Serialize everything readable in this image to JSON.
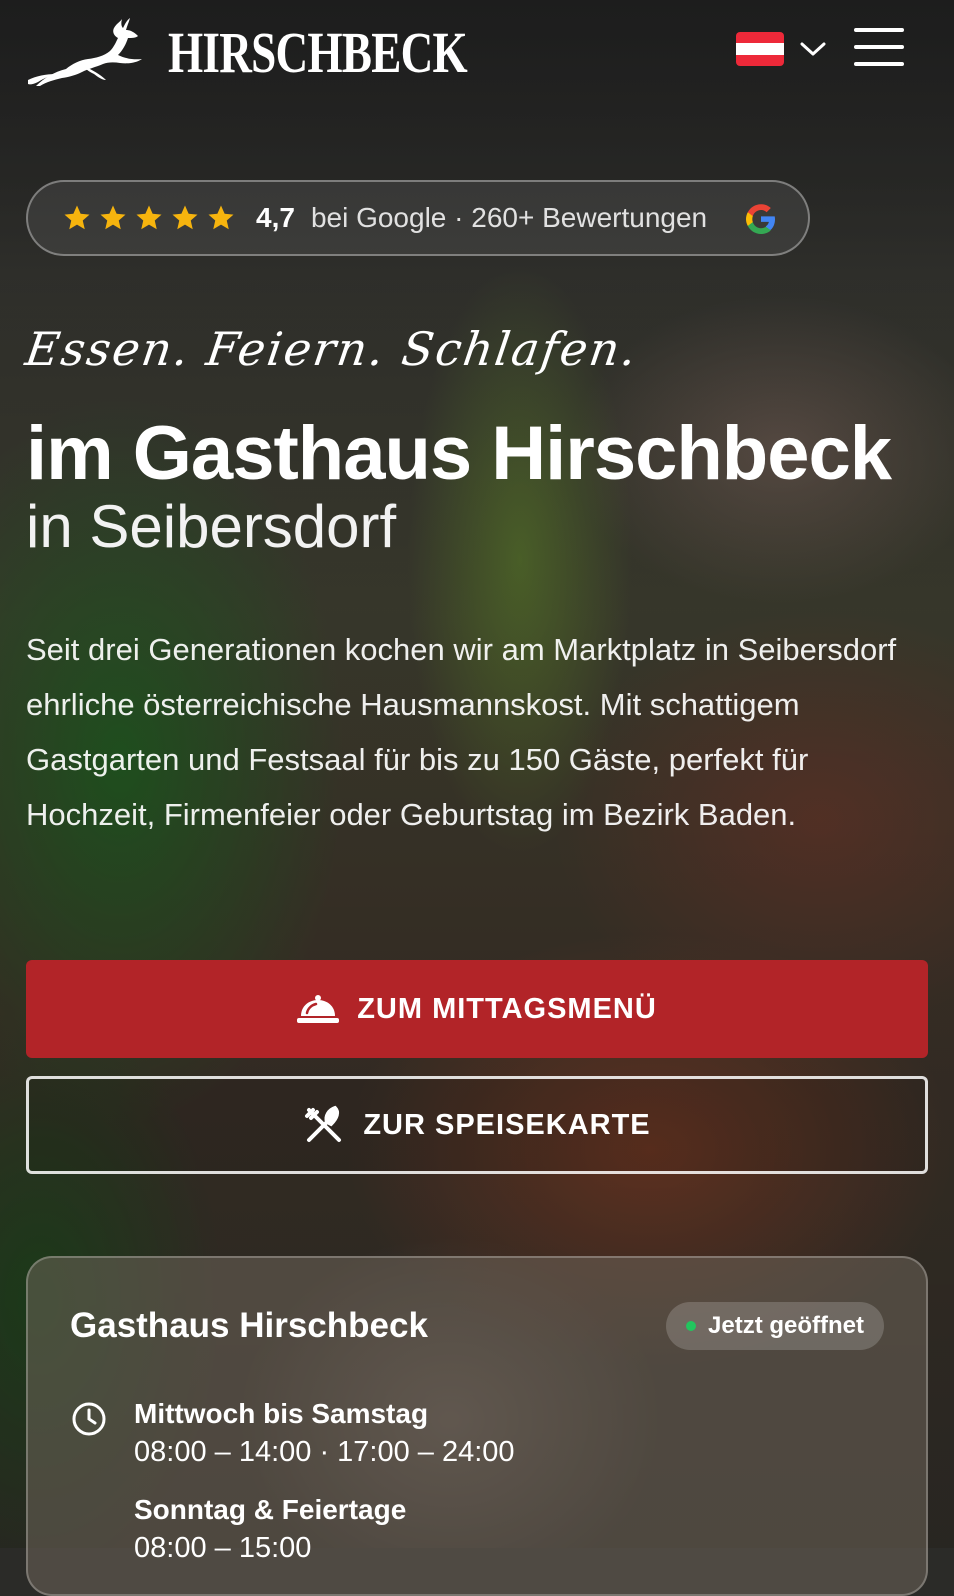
{
  "header": {
    "brand": "HIRSCHBECK",
    "logo_icon": "deer-icon",
    "language_flag": {
      "icon": "austria-flag-icon",
      "colors": [
        "#ed2939",
        "#ffffff",
        "#ed2939"
      ]
    },
    "language_dropdown_icon": "chevron-down-icon",
    "menu_icon": "hamburger-icon"
  },
  "rating": {
    "stars": 5,
    "star_color": "#f6b40e",
    "score": "4,7",
    "text": "bei Google · 260+ Bewertungen",
    "provider_icon": "google-icon"
  },
  "hero": {
    "tagline": "Essen. Feiern. Schlafen.",
    "title": "im Gasthaus Hirschbeck",
    "subtitle": "in Seibersdorf",
    "description": "Seit drei Generationen kochen wir am Marktplatz in Seibersdorf ehrliche österreichische Hausmannskost. Mit schattigem Gastgarten und Festsaal für bis zu 150 Gäste, perfekt für Hochzeit, Firmenfeier oder Geburtstag im Bezirk Baden."
  },
  "buttons": {
    "lunch_menu": {
      "label": "ZUM MITTAGSMENÜ",
      "icon": "cloche-icon",
      "color": "#b22428"
    },
    "menu_card": {
      "label": "ZUR SPEISEKARTE",
      "icon": "cutlery-icon"
    }
  },
  "info_card": {
    "title": "Gasthaus Hirschbeck",
    "status": "Jetzt geöffnet",
    "status_color": "#22c55e",
    "hours": [
      {
        "days": "Mittwoch bis Samstag",
        "times": "08:00 – 14:00 · 17:00 – 24:00"
      },
      {
        "days": "Sonntag & Feiertage",
        "times": "08:00 – 15:00"
      }
    ]
  }
}
